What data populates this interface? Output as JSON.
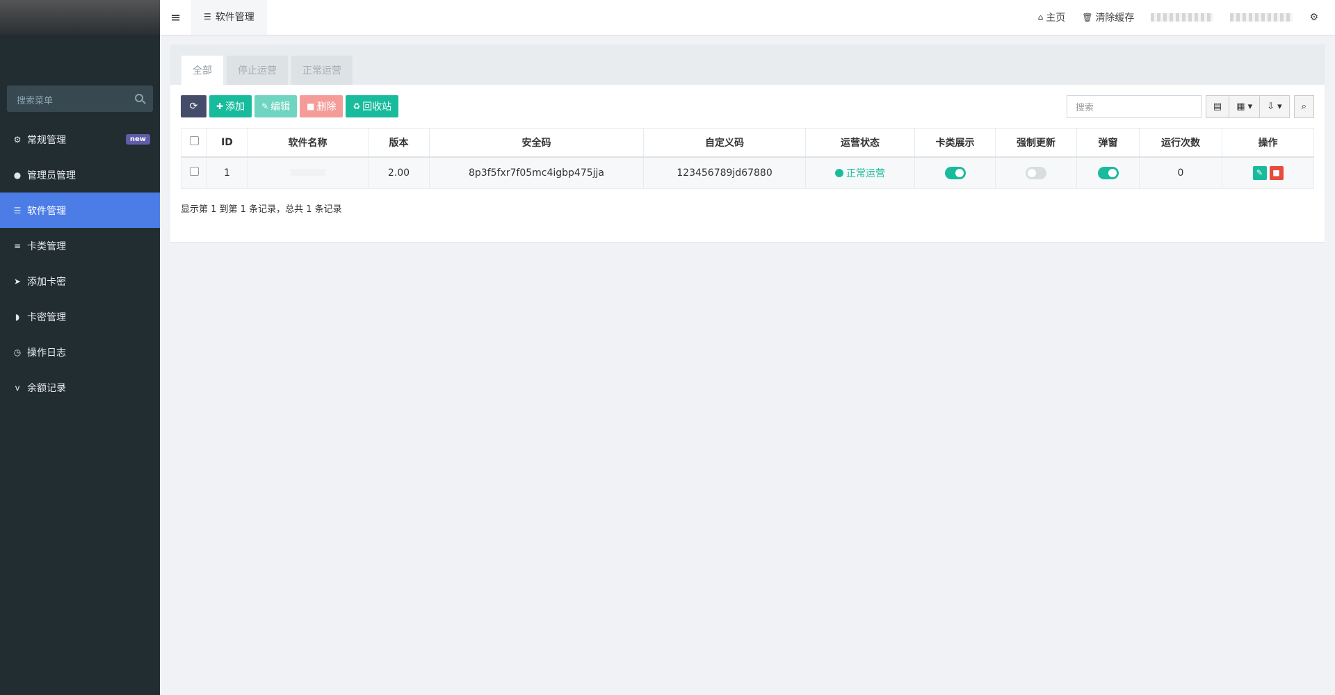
{
  "sidebar": {
    "search_placeholder": "搜索菜单",
    "items": [
      {
        "label": "常规管理",
        "icon": "cogs-icon",
        "badge": "new"
      },
      {
        "label": "管理员管理",
        "icon": "user-icon"
      },
      {
        "label": "软件管理",
        "icon": "list-icon",
        "active": true
      },
      {
        "label": "卡类管理",
        "icon": "server-icon"
      },
      {
        "label": "添加卡密",
        "icon": "paper-plane-icon"
      },
      {
        "label": "卡密管理",
        "icon": "rss-icon"
      },
      {
        "label": "操作日志",
        "icon": "clock-icon"
      },
      {
        "label": "余额记录",
        "icon": "vimeo-icon"
      }
    ]
  },
  "topbar": {
    "tab_label": "软件管理",
    "home_label": "主页",
    "clear_cache_label": "清除缓存"
  },
  "tabs": [
    "全部",
    "停止运营",
    "正常运营"
  ],
  "toolbar": {
    "add_label": "添加",
    "edit_label": "编辑",
    "delete_label": "删除",
    "recycle_label": "回收站",
    "search_placeholder": "搜索"
  },
  "table": {
    "headers": [
      "ID",
      "软件名称",
      "版本",
      "安全码",
      "自定义码",
      "运营状态",
      "卡类展示",
      "强制更新",
      "弹窗",
      "运行次数",
      "操作"
    ],
    "rows": [
      {
        "id": "1",
        "name": "",
        "version": "2.00",
        "security_code": "8p3f5fxr7f05mc4igbp475jja",
        "custom_code": "123456789jd67880",
        "status": "正常运营",
        "card_display": true,
        "force_update": false,
        "popup": true,
        "run_count": "0"
      }
    ]
  },
  "pager": "显示第 1 到第 1 条记录，总共 1 条记录",
  "colors": {
    "sidebar": "#222d32",
    "active": "#4c7ce6",
    "success": "#18bc9c",
    "danger": "#e74c3c"
  }
}
